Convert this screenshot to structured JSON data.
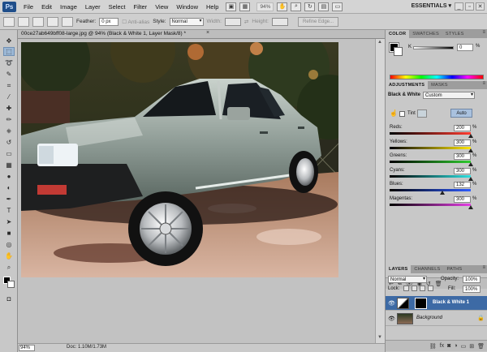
{
  "menubar": {
    "logo": "Ps",
    "items": [
      "File",
      "Edit",
      "Image",
      "Layer",
      "Select",
      "Filter",
      "View",
      "Window",
      "Help"
    ],
    "zoom": "94%",
    "workspace": "ESSENTIALS",
    "workspace_arrow": "▾",
    "window_buttons": [
      "_",
      "▫",
      "✕"
    ]
  },
  "options": {
    "feather_label": "Feather:",
    "feather_value": "0 px",
    "anti_alias_label": "Anti-alias",
    "style_label": "Style:",
    "style_value": "Normal",
    "width_label": "Width:",
    "height_label": "Height:",
    "refine_edge": "Refine Edge..."
  },
  "document": {
    "title": "00ce27ab649bff08-large.jpg @ 94% (Black & White 1, Layer Mask/8) *",
    "close_glyph": "×",
    "zoom": "94%",
    "info": "Doc: 1.10M/1.73M",
    "scroll_up": "▲",
    "scroll_down": "▼"
  },
  "color_panel": {
    "tabs": [
      "COLOR",
      "SWATCHES",
      "STYLES"
    ],
    "channel": "K",
    "value": "0",
    "unit": "%",
    "fg_color": "#000000",
    "bg_color": "#ffffff"
  },
  "adjustments_panel": {
    "tabs": [
      "ADJUSTMENTS",
      "MASKS"
    ],
    "title": "Black & White",
    "preset": "Custom",
    "tint_label": "Tint",
    "auto_label": "Auto",
    "sliders": [
      {
        "label": "Reds:",
        "value": "200",
        "unit": "%",
        "fraction": 1.0,
        "gradient": "linear-gradient(to right,#000,#ff3b2f)"
      },
      {
        "label": "Yellows:",
        "value": "300",
        "unit": "%",
        "fraction": 1.0,
        "gradient": "linear-gradient(to right,#000,#ffe600)"
      },
      {
        "label": "Greens:",
        "value": "300",
        "unit": "%",
        "fraction": 1.0,
        "gradient": "linear-gradient(to right,#000,#2ecc2e)"
      },
      {
        "label": "Cyans:",
        "value": "300",
        "unit": "%",
        "fraction": 1.0,
        "gradient": "linear-gradient(to right,#000,#2ee0e0)"
      },
      {
        "label": "Blues:",
        "value": "132",
        "unit": "%",
        "fraction": 0.65,
        "gradient": "linear-gradient(to right,#000,#2e5cff)"
      },
      {
        "label": "Magentas:",
        "value": "300",
        "unit": "%",
        "fraction": 1.0,
        "gradient": "linear-gradient(to right,#000,#e63fe6)"
      }
    ]
  },
  "layers_panel": {
    "tabs": [
      "LAYERS",
      "CHANNELS",
      "PATHS"
    ],
    "blend_mode": "Normal",
    "opacity_label": "Opacity:",
    "opacity_value": "100%",
    "lock_label": "Lock:",
    "fill_label": "Fill:",
    "fill_value": "100%",
    "layers": [
      {
        "name": "Black & White 1",
        "selected": true
      },
      {
        "name": "Background",
        "selected": false
      }
    ]
  }
}
